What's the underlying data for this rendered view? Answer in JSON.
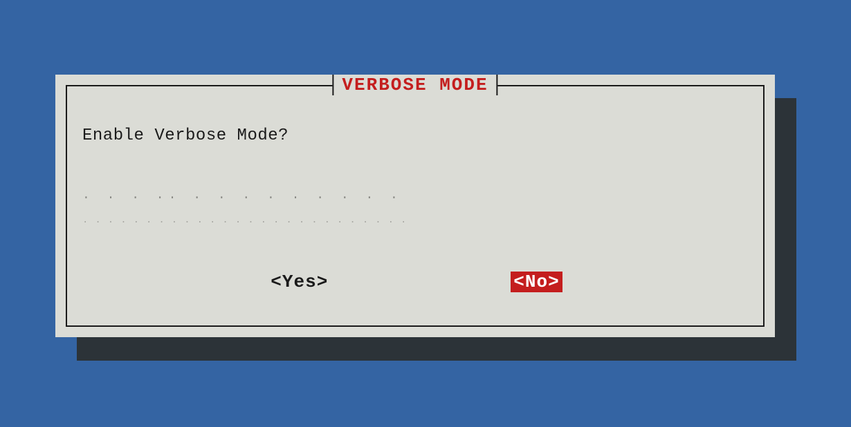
{
  "dialog": {
    "title": "VERBOSE MODE",
    "prompt": "Enable Verbose Mode?",
    "dots1": ". .  . .. . . .  .  . . . . .",
    "dots2": "..........................",
    "buttons": {
      "yes": "<Yes>",
      "no": "<No>"
    },
    "selected": "no"
  },
  "colors": {
    "background": "#3464a3",
    "dialog_bg": "#dbdcd6",
    "shadow": "#2c3338",
    "accent": "#c41e1e",
    "text": "#1a1a1a"
  }
}
